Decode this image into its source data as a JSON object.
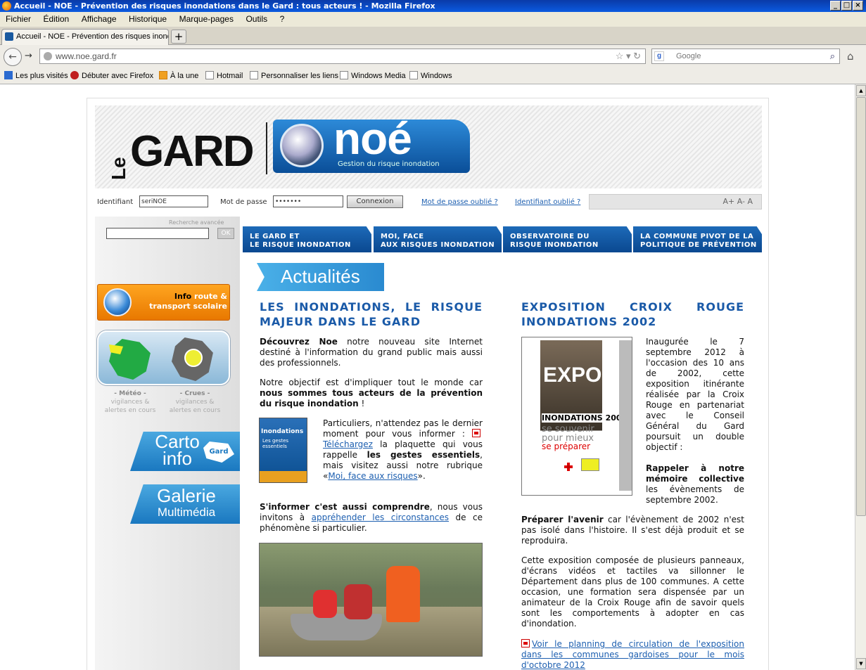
{
  "window": {
    "title": "Accueil - NOE - Prévention des risques inondations dans le Gard : tous acteurs ! - Mozilla Firefox",
    "minimize": "_",
    "maximize": "□",
    "close": "×"
  },
  "menu": [
    "Fichier",
    "Édition",
    "Affichage",
    "Historique",
    "Marque-pages",
    "Outils",
    "?"
  ],
  "tab": {
    "label": "Accueil - NOE - Prévention des risques inond...",
    "new_tab": "+"
  },
  "nav": {
    "url": "www.noe.gard.fr",
    "search_placeholder": "Google",
    "back_icon": "back-arrow-icon",
    "forward_icon": "forward-arrow-icon",
    "home_icon": "home-icon"
  },
  "bookmarks": [
    "Les plus visités",
    "Débuter avec Firefox",
    "À la une",
    "Hotmail",
    "Personnaliser les liens",
    "Windows Media",
    "Windows"
  ],
  "banner": {
    "le": "Le",
    "gard": "GARD",
    "noe": "noé",
    "noe_sub": "Gestion du risque inondation"
  },
  "login": {
    "id_label": "Identifiant",
    "id_value": "seriNOE",
    "pw_label": "Mot de passe",
    "pw_value": "•••••••",
    "connect": "Connexion",
    "forgot_pw": "Mot de passe oublié ?",
    "forgot_id": "Identifiant oublié ?",
    "font_sizes": "A+ A- A"
  },
  "sidebar": {
    "advanced_search": "Recherche avancée",
    "ok": "OK",
    "info_route_bold": "Info",
    "info_route_rest": " route & transport scolaire",
    "meteo_title": "- Météo -",
    "meteo_sub": "vigilances & alertes en cours",
    "crues_title": "- Crues -",
    "crues_sub": "vigilances & alertes en cours",
    "carto": "Carto info",
    "carto_gard": "Gard",
    "galerie": "Galerie",
    "multimedia": "Multimédia"
  },
  "navtabs": [
    {
      "l1": "LE GARD ET",
      "l2": "LE RISQUE INONDATION"
    },
    {
      "l1": "MOI, FACE",
      "l2": "AUX RISQUES INONDATION"
    },
    {
      "l1": "OBSERVATOIRE DU",
      "l2": "RISQUE INONDATION"
    },
    {
      "l1": "LA COMMUNE PIVOT DE LA",
      "l2": "POLITIQUE DE PRÉVENTION"
    }
  ],
  "actualites": "Actualités",
  "article1": {
    "title": "LES INONDATIONS, LE RISQUE MAJEUR DANS LE GARD",
    "p1_bold": "Découvrez Noe",
    "p1_rest": " notre nouveau site Internet destiné à l'information du grand public mais aussi des professionnels.",
    "p2_start": "Notre objectif est d'impliquer tout le monde car ",
    "p2_bold": "nous sommes tous acteurs de la prévention du risque inondation",
    "p2_end": " !",
    "p3_a": "Particuliers, n'attendez pas le dernier moment pour vous informer : ",
    "p3_link": "Téléchargez",
    "p3_b": " la plaquette qui vous rappelle ",
    "p3_bold": "les gestes essentiels",
    "p3_c": ", mais visitez aussi notre rubrique «",
    "p3_link2": "Moi, face aux risques",
    "p3_d": "».",
    "p4_bold": "S'informer c'est aussi comprendre",
    "p4_a": ", nous vous invitons à ",
    "p4_link": "appréhender les circonstances",
    "p4_b": " de ce phénomène si particulier.",
    "book_title": "Inondations",
    "book_sub": "Les gestes essentiels"
  },
  "article2": {
    "title": "EXPOSITION CROIX ROUGE INONDATIONS 2002",
    "p1": "Inaugurée le 7 septembre 2012 à l'occasion des 10 ans de 2002, cette exposition itinérante réalisée par la Croix Rouge en partenariat avec le Conseil Général du Gard poursuit un double objectif :",
    "p2_bold": "Rappeler à notre mémoire collective",
    "p2_rest": " les évènements de septembre 2002.",
    "p3_bold": "Préparer l'avenir",
    "p3_rest": " car l'évènement de 2002 n'est pas isolé dans l'histoire. Il s'est déjà produit et se reproduira.",
    "p4": "Cette exposition composée de plusieurs panneaux, d'écrans vidéos et tactiles va sillonner le Département dans plus de 100 communes. A cette occasion, une formation sera dispensée par un animateur de la Croix Rouge afin de savoir quels sont les comportements à adopter en cas d'inondation.",
    "link": "Voir le planning de circulation de l'exposition dans les communes gardoises pour le mois d'octobre 2012",
    "poster_expo": "EXPO",
    "poster_inond": "INONDATIONS",
    "poster_year": "2002",
    "poster_s1": "se souvenir",
    "poster_s1b": "pour mieux",
    "poster_s2": "se préparer"
  }
}
